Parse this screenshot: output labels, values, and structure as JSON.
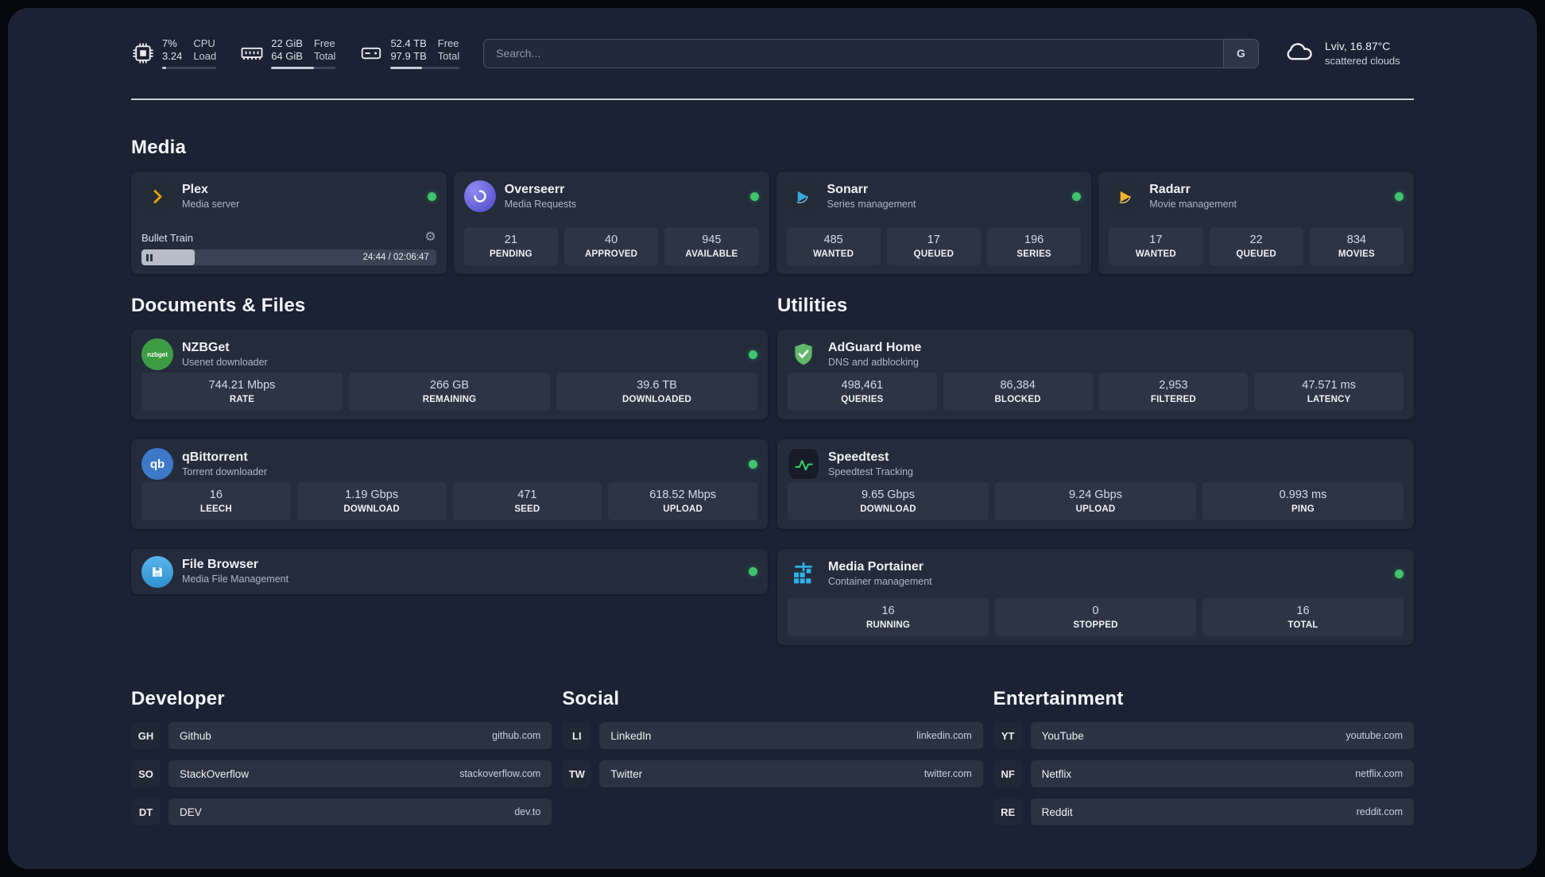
{
  "topbar": {
    "cpu": {
      "value_top": "7%",
      "value_bottom": "3.24",
      "label_top": "CPU",
      "label_bottom": "Load",
      "bar_percent": 7
    },
    "ram": {
      "value_top": "22 GiB",
      "value_bottom": "64 GiB",
      "label_top": "Free",
      "label_bottom": "Total",
      "bar_percent": 66
    },
    "disk": {
      "value_top": "52.4 TB",
      "value_bottom": "97.9 TB",
      "label_top": "Free",
      "label_bottom": "Total",
      "bar_percent": 46
    },
    "search": {
      "placeholder": "Search...",
      "button": "G"
    },
    "weather": {
      "location": "Lviv, 16.87°C",
      "condition": "scattered clouds"
    }
  },
  "media": {
    "title": "Media",
    "plex": {
      "name": "Plex",
      "subtitle": "Media server",
      "now_playing": "Bullet Train",
      "time": "24:44 / 02:06:47",
      "progress_percent": 18
    },
    "overseerr": {
      "name": "Overseerr",
      "subtitle": "Media Requests",
      "stats": [
        {
          "value": "21",
          "label": "PENDING"
        },
        {
          "value": "40",
          "label": "APPROVED"
        },
        {
          "value": "945",
          "label": "AVAILABLE"
        }
      ]
    },
    "sonarr": {
      "name": "Sonarr",
      "subtitle": "Series management",
      "stats": [
        {
          "value": "485",
          "label": "WANTED"
        },
        {
          "value": "17",
          "label": "QUEUED"
        },
        {
          "value": "196",
          "label": "SERIES"
        }
      ]
    },
    "radarr": {
      "name": "Radarr",
      "subtitle": "Movie management",
      "stats": [
        {
          "value": "17",
          "label": "WANTED"
        },
        {
          "value": "22",
          "label": "QUEUED"
        },
        {
          "value": "834",
          "label": "MOVIES"
        }
      ]
    }
  },
  "documents": {
    "title": "Documents & Files",
    "nzbget": {
      "name": "NZBGet",
      "subtitle": "Usenet downloader",
      "icon_text": "nzbget",
      "stats": [
        {
          "value": "744.21 Mbps",
          "label": "RATE"
        },
        {
          "value": "266 GB",
          "label": "REMAINING"
        },
        {
          "value": "39.6 TB",
          "label": "DOWNLOADED"
        }
      ]
    },
    "qbittorrent": {
      "name": "qBittorrent",
      "subtitle": "Torrent downloader",
      "icon_text": "qb",
      "stats": [
        {
          "value": "16",
          "label": "LEECH"
        },
        {
          "value": "1.19 Gbps",
          "label": "DOWNLOAD"
        },
        {
          "value": "471",
          "label": "SEED"
        },
        {
          "value": "618.52 Mbps",
          "label": "UPLOAD"
        }
      ]
    },
    "filebrowser": {
      "name": "File Browser",
      "subtitle": "Media File Management"
    }
  },
  "utilities": {
    "title": "Utilities",
    "adguard": {
      "name": "AdGuard Home",
      "subtitle": "DNS and adblocking",
      "stats": [
        {
          "value": "498,461",
          "label": "QUERIES"
        },
        {
          "value": "86,384",
          "label": "BLOCKED"
        },
        {
          "value": "2,953",
          "label": "FILTERED"
        },
        {
          "value": "47.571 ms",
          "label": "LATENCY"
        }
      ]
    },
    "speedtest": {
      "name": "Speedtest",
      "subtitle": "Speedtest Tracking",
      "stats": [
        {
          "value": "9.65 Gbps",
          "label": "DOWNLOAD"
        },
        {
          "value": "9.24 Gbps",
          "label": "UPLOAD"
        },
        {
          "value": "0.993 ms",
          "label": "PING"
        }
      ]
    },
    "portainer": {
      "name": "Media Portainer",
      "subtitle": "Container management",
      "stats": [
        {
          "value": "16",
          "label": "RUNNING"
        },
        {
          "value": "0",
          "label": "STOPPED"
        },
        {
          "value": "16",
          "label": "TOTAL"
        }
      ]
    }
  },
  "links": {
    "developer": {
      "title": "Developer",
      "items": [
        {
          "abbr": "GH",
          "name": "Github",
          "url": "github.com"
        },
        {
          "abbr": "SO",
          "name": "StackOverflow",
          "url": "stackoverflow.com"
        },
        {
          "abbr": "DT",
          "name": "DEV",
          "url": "dev.to"
        }
      ]
    },
    "social": {
      "title": "Social",
      "items": [
        {
          "abbr": "LI",
          "name": "LinkedIn",
          "url": "linkedin.com"
        },
        {
          "abbr": "TW",
          "name": "Twitter",
          "url": "twitter.com"
        }
      ]
    },
    "entertainment": {
      "title": "Entertainment",
      "items": [
        {
          "abbr": "YT",
          "name": "YouTube",
          "url": "youtube.com"
        },
        {
          "abbr": "NF",
          "name": "Netflix",
          "url": "netflix.com"
        },
        {
          "abbr": "RE",
          "name": "Reddit",
          "url": "reddit.com"
        }
      ]
    }
  },
  "colors": {
    "status_green": "#3ec46d",
    "plex_orange": "#e5a00d",
    "sonarr_blue": "#39a9e0",
    "radarr_yellow": "#f7b32b",
    "overseerr_purple": "#6257d6",
    "nzbget_green": "#3d9c44",
    "qbittorrent_blue": "#3d78c9",
    "filebrowser_blue": "#3f9fdc",
    "adguard_green": "#61b86b",
    "speedtest_green": "#35d06a",
    "portainer_blue": "#2fb1e8"
  }
}
